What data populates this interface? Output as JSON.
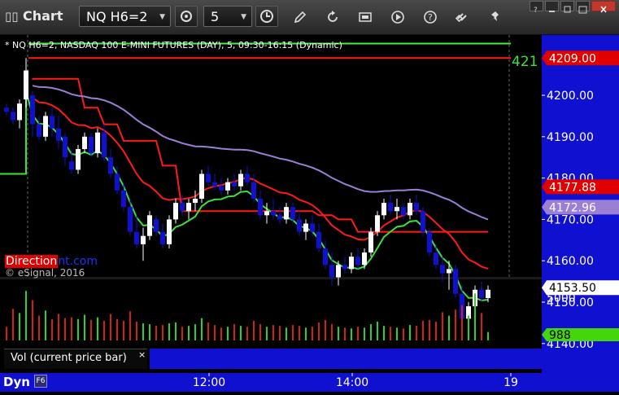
{
  "window": {
    "title": "Chart"
  },
  "toolbar": {
    "symbol": "NQ H6=2",
    "interval": "5"
  },
  "chart": {
    "header": "* NQ H6=2, NASDAQ 100 E-MINI FUTURES (DAY), 5, 09:30-16:15 (Dynamic)",
    "brand_part1": "Direction",
    "brand_part2": "nt.com",
    "copyright": "© eSignal, 2016",
    "right_edge_label": "421",
    "volume_pane_label": "Vol (current price bar)",
    "volume_close": "×",
    "dyn_label": "Dyn",
    "dyn_icon": "F6"
  },
  "chart_data": {
    "type": "candlestick",
    "price_axis_labels": [
      "4200.00",
      "4190.00",
      "4180.00",
      "4170.00",
      "4160.00",
      "4150.00",
      "4140.00"
    ],
    "ylim": [
      4140,
      4209
    ],
    "price_tags": [
      {
        "text": "4209.00",
        "color": "#e00000",
        "price": 4209.0
      },
      {
        "text": "4177.88",
        "color": "#e00000",
        "price": 4177.88
      },
      {
        "text": "4172.96",
        "color": "#9b7fd4",
        "price": 4172.96
      },
      {
        "text": "4153.50",
        "color": "#ffffff",
        "price": 4153.5
      }
    ],
    "volume_axis_labels": [
      "5000"
    ],
    "volume_tag": {
      "text": "988",
      "color": "#44d60a"
    },
    "x_labels": [
      "12:00",
      "14:00",
      "19"
    ],
    "colors": {
      "up": "#ffffff",
      "down": "#1010d0",
      "red_line": "#ff1a1a",
      "purple_line": "#9b7fd4",
      "green_line": "#3ee03e",
      "top_line": "#44ee44"
    },
    "candles_ohlc": [
      [
        4197,
        4198,
        4195,
        4196
      ],
      [
        4196,
        4197,
        4193,
        4194
      ],
      [
        4194,
        4199,
        4192,
        4198
      ],
      [
        4199,
        4209,
        4197,
        4206
      ],
      [
        4200,
        4201,
        4190,
        4193
      ],
      [
        4193,
        4195,
        4189,
        4190
      ],
      [
        4190,
        4196,
        4189,
        4195
      ],
      [
        4195,
        4197,
        4190,
        4192
      ],
      [
        4192,
        4195,
        4187,
        4189
      ],
      [
        4190,
        4191,
        4183,
        4185
      ],
      [
        4184,
        4187,
        4181,
        4182
      ],
      [
        4182,
        4188,
        4181,
        4187
      ],
      [
        4187,
        4191,
        4186,
        4190
      ],
      [
        4190,
        4191,
        4185,
        4186
      ],
      [
        4186,
        4192,
        4185,
        4191
      ],
      [
        4191,
        4193,
        4184,
        4185
      ],
      [
        4185,
        4187,
        4180,
        4181
      ],
      [
        4181,
        4183,
        4176,
        4177
      ],
      [
        4177,
        4179,
        4172,
        4173
      ],
      [
        4173,
        4175,
        4166,
        4167
      ],
      [
        4167,
        4171,
        4163,
        4164
      ],
      [
        4164,
        4168,
        4160,
        4166
      ],
      [
        4166,
        4172,
        4165,
        4171
      ],
      [
        4170,
        4171,
        4166,
        4167
      ],
      [
        4167,
        4169,
        4163,
        4164
      ],
      [
        4164,
        4171,
        4163,
        4170
      ],
      [
        4170,
        4175,
        4169,
        4174
      ],
      [
        4174,
        4176,
        4171,
        4172
      ],
      [
        4172,
        4175,
        4170,
        4174
      ],
      [
        4174,
        4177,
        4172,
        4175
      ],
      [
        4175,
        4182,
        4174,
        4181
      ],
      [
        4181,
        4183,
        4178,
        4179
      ],
      [
        4179,
        4181,
        4177,
        4178
      ],
      [
        4178,
        4180,
        4176,
        4177
      ],
      [
        4177,
        4180,
        4176,
        4179
      ],
      [
        4179,
        4181,
        4177,
        4178
      ],
      [
        4178,
        4182,
        4177,
        4181
      ],
      [
        4181,
        4183,
        4178,
        4179
      ],
      [
        4179,
        4181,
        4174,
        4175
      ],
      [
        4175,
        4177,
        4170,
        4171
      ],
      [
        4171,
        4174,
        4169,
        4172
      ],
      [
        4172,
        4175,
        4170,
        4171
      ],
      [
        4171,
        4173,
        4169,
        4170
      ],
      [
        4170,
        4174,
        4169,
        4173
      ],
      [
        4173,
        4174,
        4169,
        4170
      ],
      [
        4170,
        4172,
        4166,
        4167
      ],
      [
        4167,
        4170,
        4165,
        4169
      ],
      [
        4169,
        4171,
        4166,
        4167
      ],
      [
        4167,
        4169,
        4162,
        4163
      ],
      [
        4163,
        4165,
        4158,
        4159
      ],
      [
        4159,
        4162,
        4154,
        4156
      ],
      [
        4156,
        4160,
        4154,
        4159
      ],
      [
        4159,
        4161,
        4157,
        4158
      ],
      [
        4158,
        4162,
        4157,
        4161
      ],
      [
        4161,
        4163,
        4158,
        4159
      ],
      [
        4159,
        4163,
        4158,
        4162
      ],
      [
        4162,
        4168,
        4161,
        4167
      ],
      [
        4167,
        4172,
        4166,
        4171
      ],
      [
        4171,
        4175,
        4170,
        4174
      ],
      [
        4174,
        4176,
        4171,
        4172
      ],
      [
        4172,
        4175,
        4170,
        4173
      ],
      [
        4173,
        4174,
        4170,
        4171
      ],
      [
        4171,
        4175,
        4170,
        4174
      ],
      [
        4174,
        4176,
        4171,
        4172
      ],
      [
        4172,
        4173,
        4166,
        4167
      ],
      [
        4167,
        4168,
        4161,
        4162
      ],
      [
        4162,
        4164,
        4158,
        4159
      ],
      [
        4159,
        4161,
        4155,
        4157
      ],
      [
        4157,
        4160,
        4153,
        4158
      ],
      [
        4158,
        4159,
        4151,
        4152
      ],
      [
        4152,
        4154,
        4144,
        4146
      ],
      [
        4146,
        4150,
        4145,
        4149
      ],
      [
        4149,
        4154,
        4148,
        4153
      ],
      [
        4153,
        4155,
        4150,
        4151
      ],
      [
        4151,
        4154,
        4150,
        4153
      ]
    ],
    "volumes": [
      1600,
      3700,
      3200,
      5800,
      4700,
      2900,
      3500,
      2500,
      3100,
      2600,
      2700,
      2500,
      3000,
      2400,
      2700,
      2300,
      3100,
      2500,
      2300,
      3400,
      2200,
      2000,
      1900,
      1700,
      1800,
      2000,
      2100,
      1600,
      1700,
      1900,
      2600,
      2100,
      1800,
      1500,
      1600,
      1900,
      1700,
      1600,
      2300,
      1900,
      1600,
      1800,
      1700,
      1500,
      1800,
      1700,
      1500,
      1600,
      2100,
      2400,
      1900,
      1600,
      1500,
      1400,
      1600,
      1500,
      1900,
      2200,
      1700,
      1600,
      1500,
      1400,
      1800,
      1700,
      2300,
      2400,
      2200,
      3300,
      2900,
      3600,
      4100,
      2900,
      5500,
      3200,
      988
    ]
  }
}
